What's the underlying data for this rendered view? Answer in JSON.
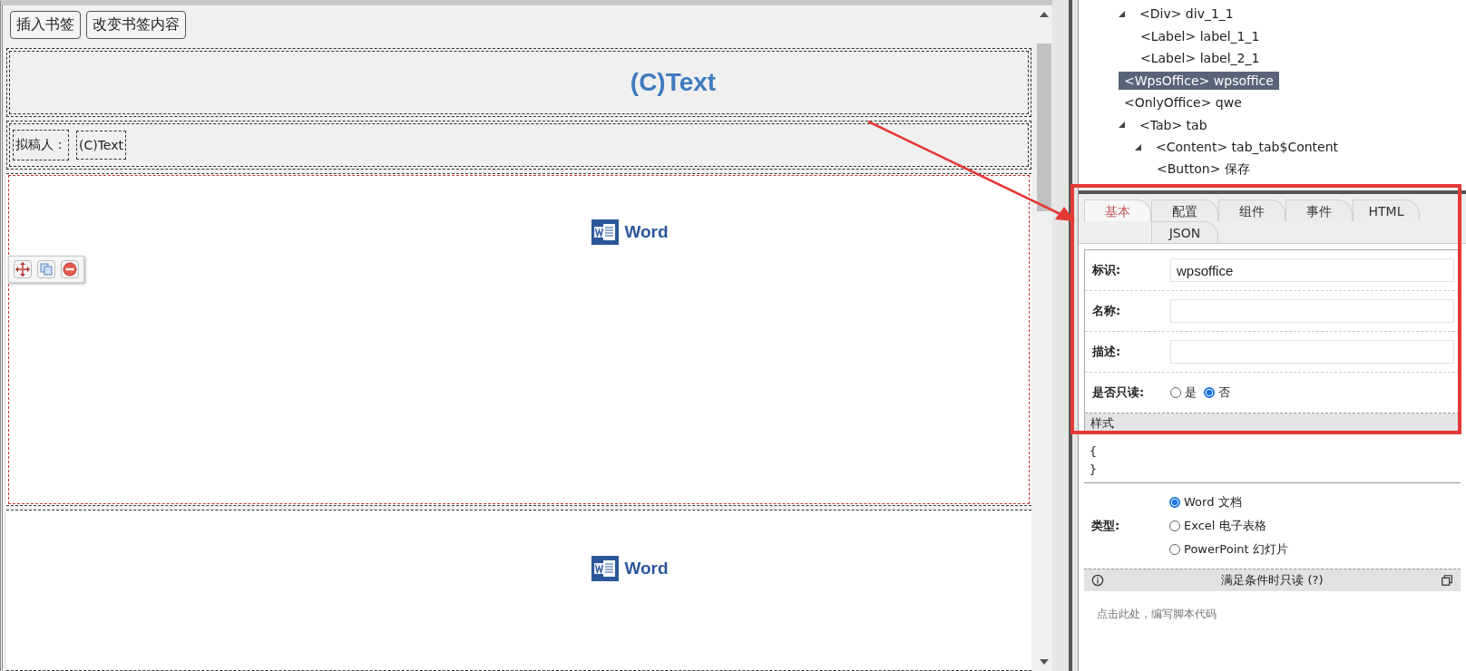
{
  "toolbar": {
    "buttons": [
      "插入书签",
      "改变书签内容"
    ]
  },
  "canvas": {
    "title_text": "(C)Text",
    "drafter": {
      "label": "拟稿人：",
      "value": "(C)Text"
    },
    "documents": [
      {
        "kind": "word",
        "label": "Word",
        "selected": true
      },
      {
        "kind": "word",
        "label": "Word",
        "selected": false
      }
    ]
  },
  "tree": [
    {
      "label": "<Div> div_1_1",
      "expanded": true,
      "selected": false,
      "children": [
        {
          "label": "<Label> label_1_1",
          "selected": false
        },
        {
          "label": "<Label> label_2_1",
          "selected": false
        }
      ]
    },
    {
      "label": "<WpsOffice> wpsoffice",
      "selected": true
    },
    {
      "label": "<OnlyOffice> qwe",
      "selected": false
    },
    {
      "label": "<Tab> tab",
      "expanded": true,
      "selected": false,
      "children": [
        {
          "label": "<Content> tab_tab$Content",
          "expanded": true,
          "selected": false,
          "children": [
            {
              "label": "<Button> 保存",
              "selected": false
            }
          ]
        }
      ]
    }
  ],
  "properties": {
    "tabs": [
      {
        "label": "基本",
        "selected": true
      },
      {
        "label": "配置",
        "selected": false
      },
      {
        "label": "组件",
        "selected": false
      },
      {
        "label": "事件",
        "selected": false
      },
      {
        "label": "HTML",
        "selected": false
      },
      {
        "label": "JSON",
        "selected": false
      }
    ],
    "fields": [
      {
        "label": "标识:",
        "value": "wpsoffice"
      },
      {
        "label": "名称:"
      },
      {
        "label": "描述:"
      }
    ],
    "readonly": {
      "label": "是否只读:",
      "options": [
        {
          "label": "是",
          "selected": false
        },
        {
          "label": "否",
          "selected": true
        }
      ]
    },
    "style": {
      "title": "样式",
      "code": [
        "{",
        "}"
      ]
    },
    "type": {
      "label": "类型:",
      "options": [
        {
          "label": "Word 文档",
          "selected": true
        },
        {
          "label": "Excel 电子表格",
          "selected": false
        },
        {
          "label": "PowerPoint 幻灯片",
          "selected": false
        }
      ]
    },
    "script": {
      "title": "满足条件时只读 (?)",
      "placeholder": "点击此处，编写脚本代码"
    }
  }
}
